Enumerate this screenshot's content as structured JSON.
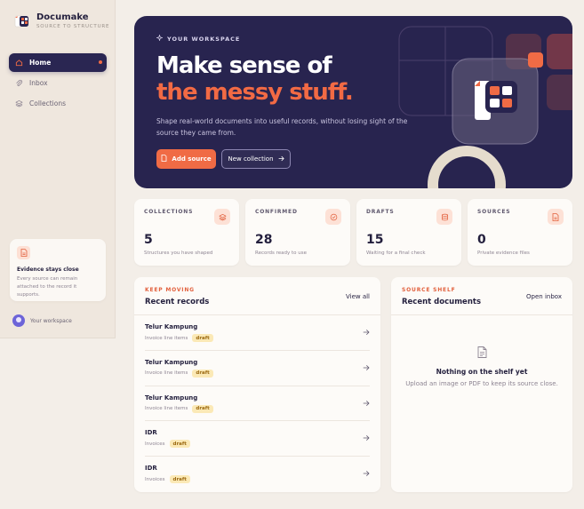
{
  "brand": {
    "name": "Documake",
    "tagline": "SOURCE TO STRUCTURE"
  },
  "nav": {
    "items": [
      {
        "label": "Home",
        "icon": "home-icon",
        "active": true
      },
      {
        "label": "Inbox",
        "icon": "paperclip-icon",
        "active": false
      },
      {
        "label": "Collections",
        "icon": "layers-icon",
        "active": false
      }
    ]
  },
  "evidence": {
    "title": "Evidence stays close",
    "text": "Every source can remain attached to the record it supports."
  },
  "user": {
    "label": "Your workspace"
  },
  "hero": {
    "eyebrow": "YOUR WORKSPACE",
    "title_line1": "Make sense of",
    "title_line2": "the messy stuff.",
    "description": "Shape real-world documents into useful records, without losing sight of the source they came from.",
    "primary_label": "Add source",
    "secondary_label": "New collection"
  },
  "stats": [
    {
      "label": "COLLECTIONS",
      "value": "5",
      "sub": "Structures you have shaped",
      "icon": "layers-icon"
    },
    {
      "label": "CONFIRMED",
      "value": "28",
      "sub": "Records ready to use",
      "icon": "check-circle-icon"
    },
    {
      "label": "DRAFTS",
      "value": "15",
      "sub": "Waiting for a final check",
      "icon": "database-icon"
    },
    {
      "label": "SOURCES",
      "value": "0",
      "sub": "Private evidence files",
      "icon": "file-icon"
    }
  ],
  "records_panel": {
    "eyebrow": "KEEP MOVING",
    "title": "Recent records",
    "action": "View all",
    "rows": [
      {
        "name": "Telur Kampung",
        "meta": "Invoice line items",
        "badge": "draft"
      },
      {
        "name": "Telur Kampung",
        "meta": "Invoice line items",
        "badge": "draft"
      },
      {
        "name": "Telur Kampung",
        "meta": "Invoice line items",
        "badge": "draft"
      },
      {
        "name": "IDR",
        "meta": "Invoices",
        "badge": "draft"
      },
      {
        "name": "IDR",
        "meta": "Invoices",
        "badge": "draft"
      }
    ]
  },
  "docs_panel": {
    "eyebrow": "SOURCE SHELF",
    "title": "Recent documents",
    "action": "Open inbox",
    "empty_title": "Nothing on the shelf yet",
    "empty_text": "Upload an image or PDF to keep its source close."
  },
  "colors": {
    "accent": "#f06b45",
    "navy": "#28244f",
    "badge_bg": "#fbe9b6",
    "background": "#f3eee8"
  }
}
